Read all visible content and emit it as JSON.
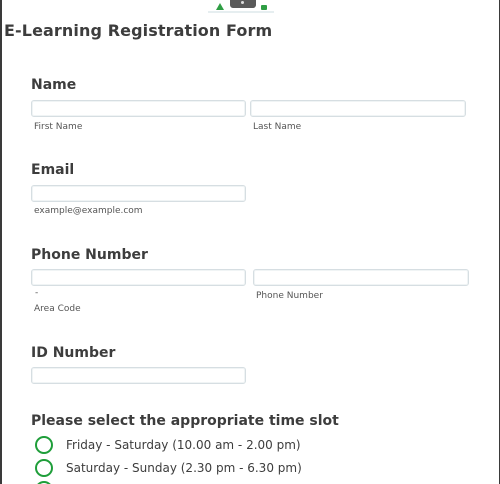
{
  "form": {
    "title": "E-Learning Registration Form"
  },
  "name": {
    "label": "Name",
    "first_sublabel": "First Name",
    "last_sublabel": "Last Name",
    "first_value": "",
    "last_value": ""
  },
  "email": {
    "label": "Email",
    "sublabel": "example@example.com",
    "value": ""
  },
  "phone": {
    "label": "Phone Number",
    "separator": "-",
    "area_sublabel": "Area Code",
    "number_sublabel": "Phone Number",
    "area_value": "",
    "number_value": ""
  },
  "id_number": {
    "label": "ID Number",
    "value": ""
  },
  "time_slot": {
    "label": "Please select the appropriate time slot",
    "options": [
      {
        "label": "Friday - Saturday (10.00 am - 2.00 pm)"
      },
      {
        "label": "Saturday - Sunday (2.30 pm - 6.30 pm)"
      }
    ]
  },
  "colors": {
    "accent": "#1f9e3a",
    "input_border": "#d6dee2",
    "text": "#3d3d3d"
  }
}
